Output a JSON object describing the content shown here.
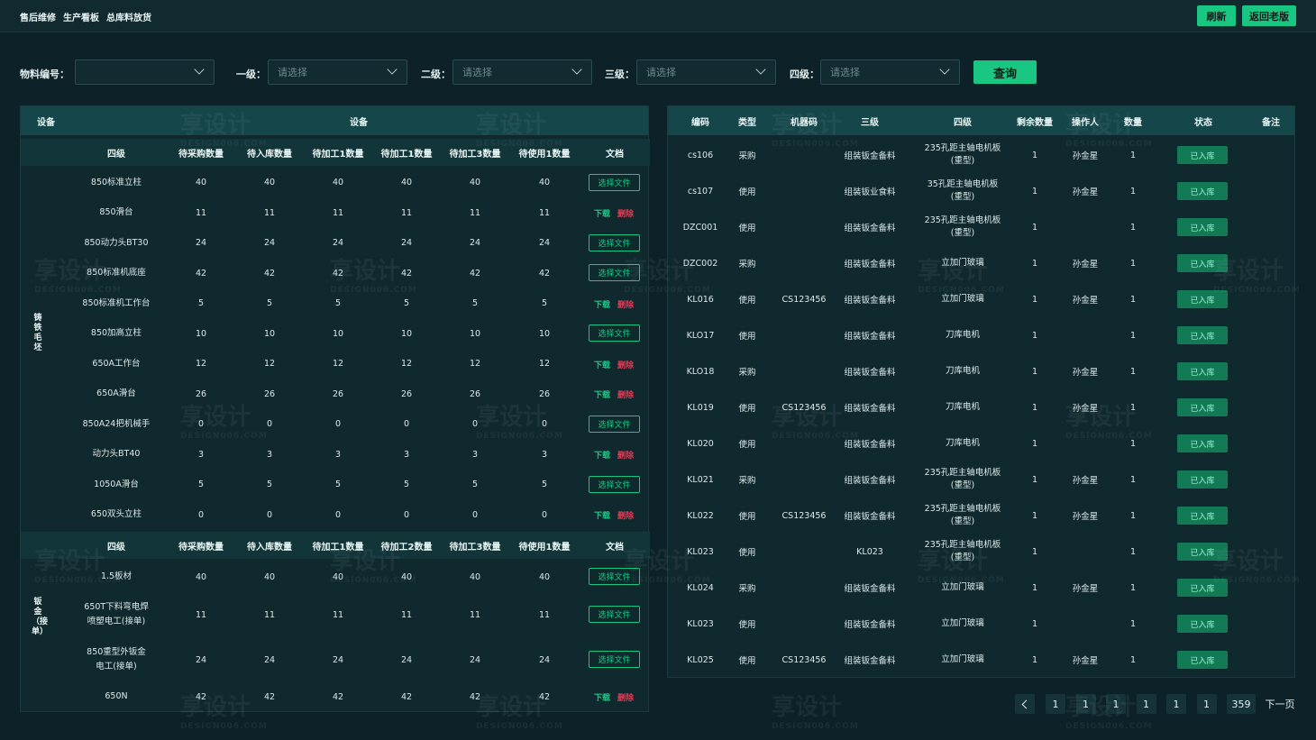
{
  "topnav": [
    "售后维修",
    "生产看板",
    "总库料放货"
  ],
  "buttons": {
    "refresh": "刷新",
    "old_version": "返回老版",
    "query": "查询"
  },
  "filters": {
    "material_label": "物料编号：",
    "material_value": "",
    "l1_label": "一级：",
    "l1_placeholder": "请选择",
    "l2_label": "二级：",
    "l2_placeholder": "请选择",
    "l3_label": "三级：",
    "l3_placeholder": "请选择",
    "l4_label": "四级：",
    "l4_placeholder": "请选择"
  },
  "left": {
    "head_device": "设备",
    "head_device2": "设备",
    "columns1": [
      "四级",
      "待采购数量",
      "待入库数量",
      "待加工1数量",
      "待加工1数量",
      "待加工3数量",
      "待使用1数量",
      "文档"
    ],
    "group1_label": "铸铁毛坯",
    "rows1": [
      {
        "name": "850标准立柱",
        "v": [
          "40",
          "40",
          "40",
          "40",
          "40",
          "40"
        ],
        "doc": "file"
      },
      {
        "name": "850滑台",
        "v": [
          "11",
          "11",
          "11",
          "11",
          "11",
          "11"
        ],
        "doc": "dl"
      },
      {
        "name": "850动力头BT30",
        "v": [
          "24",
          "24",
          "24",
          "24",
          "24",
          "24"
        ],
        "doc": "file"
      },
      {
        "name": "850标准机底座",
        "v": [
          "42",
          "42",
          "42",
          "42",
          "42",
          "42"
        ],
        "doc": "file"
      },
      {
        "name": "850标准机工作台",
        "v": [
          "5",
          "5",
          "5",
          "5",
          "5",
          "5"
        ],
        "doc": "dl"
      },
      {
        "name": "850加高立柱",
        "v": [
          "10",
          "10",
          "10",
          "10",
          "10",
          "10"
        ],
        "doc": "file"
      },
      {
        "name": "650A工作台",
        "v": [
          "12",
          "12",
          "12",
          "12",
          "12",
          "12"
        ],
        "doc": "dl"
      },
      {
        "name": "650A滑台",
        "v": [
          "26",
          "26",
          "26",
          "26",
          "26",
          "26"
        ],
        "doc": "dl"
      },
      {
        "name": "850A24把机械手",
        "v": [
          "0",
          "0",
          "0",
          "0",
          "0",
          "0"
        ],
        "doc": "file"
      },
      {
        "name": "动力头BT40",
        "v": [
          "3",
          "3",
          "3",
          "3",
          "3",
          "3"
        ],
        "doc": "dl"
      },
      {
        "name": "1050A滑台",
        "v": [
          "5",
          "5",
          "5",
          "5",
          "5",
          "5"
        ],
        "doc": "file"
      },
      {
        "name": "650双头立柱",
        "v": [
          "0",
          "0",
          "0",
          "0",
          "0",
          "0"
        ],
        "doc": "dl"
      }
    ],
    "columns2": [
      "四级",
      "待采购数量",
      "待入库数量",
      "待加工1数量",
      "待加工2数量",
      "待加工3数量",
      "待使用1数量",
      "文档"
    ],
    "group2_label": "钣金（接单）",
    "rows2": [
      {
        "name": "1.5板材",
        "v": [
          "40",
          "40",
          "40",
          "40",
          "40",
          "40"
        ],
        "doc": "file"
      },
      {
        "name": "650T下料弯电焊\n喷塑电工(接单)",
        "v": [
          "11",
          "11",
          "11",
          "11",
          "11",
          "11"
        ],
        "doc": "file"
      },
      {
        "name": "850重型外钣金\n电工(接单)",
        "v": [
          "24",
          "24",
          "24",
          "24",
          "24",
          "24"
        ],
        "doc": "file"
      },
      {
        "name": "650N",
        "v": [
          "42",
          "42",
          "42",
          "42",
          "42",
          "42"
        ],
        "doc": "dl"
      }
    ],
    "file_label": "选择文件",
    "download_label": "下载",
    "delete_label": "删除"
  },
  "right": {
    "columns": [
      "编码",
      "类型",
      "机器码",
      "三级",
      "四级",
      "剩余数量",
      "操作人",
      "数量",
      "状态",
      "备注"
    ],
    "status_label": "已入库",
    "rows": [
      {
        "code": "cs106",
        "type": "采购",
        "machine": "",
        "l3": "组装钣金备料",
        "l4": "235孔距主轴电机板\n(重型)",
        "remain": "1",
        "op": "孙金星",
        "qty": "1"
      },
      {
        "code": "cs107",
        "type": "使用",
        "machine": "",
        "l3": "组装钣业食料",
        "l4": "35孔距主轴电机板\n(重型)",
        "remain": "1",
        "op": "孙金星",
        "qty": "1"
      },
      {
        "code": "DZC001",
        "type": "使用",
        "machine": "",
        "l3": "组装钣金备料",
        "l4": "235孔距主轴电机板\n(重型)",
        "remain": "1",
        "op": "",
        "qty": "1"
      },
      {
        "code": "DZC002",
        "type": "采购",
        "machine": "",
        "l3": "组装钣金备料",
        "l4": "立加门玻璃",
        "remain": "1",
        "op": "孙金星",
        "qty": "1"
      },
      {
        "code": "KL016",
        "type": "使用",
        "machine": "CS123456",
        "l3": "组装钣金备料",
        "l4": "立加门玻璃",
        "remain": "1",
        "op": "孙金星",
        "qty": "1"
      },
      {
        "code": "KLO17",
        "type": "使用",
        "machine": "",
        "l3": "组装钣金备料",
        "l4": "刀库电机",
        "remain": "1",
        "op": "",
        "qty": "1"
      },
      {
        "code": "KLO18",
        "type": "采购",
        "machine": "",
        "l3": "组装钣金备料",
        "l4": "刀库电机",
        "remain": "1",
        "op": "孙金星",
        "qty": "1"
      },
      {
        "code": "KL019",
        "type": "使用",
        "machine": "CS123456",
        "l3": "组装钣金备料",
        "l4": "刀库电机",
        "remain": "1",
        "op": "孙金星",
        "qty": "1"
      },
      {
        "code": "KL020",
        "type": "使用",
        "machine": "",
        "l3": "组装钣金备料",
        "l4": "刀库电机",
        "remain": "1",
        "op": "",
        "qty": "1"
      },
      {
        "code": "KL021",
        "type": "采购",
        "machine": "",
        "l3": "组装钣金备料",
        "l4": "235孔距主轴电机板\n(重型)",
        "remain": "1",
        "op": "孙金星",
        "qty": "1"
      },
      {
        "code": "KL022",
        "type": "使用",
        "machine": "CS123456",
        "l3": "组装钣金备料",
        "l4": "235孔距主轴电机板\n(重型)",
        "remain": "1",
        "op": "孙金星",
        "qty": "1"
      },
      {
        "code": "KL023",
        "type": "使用",
        "machine": "",
        "l3": "KL023",
        "l4": "235孔距主轴电机板\n(重型)",
        "remain": "1",
        "op": "",
        "qty": "1"
      },
      {
        "code": "KL024",
        "type": "采购",
        "machine": "",
        "l3": "组装钣金备料",
        "l4": "立加门玻璃",
        "remain": "1",
        "op": "孙金星",
        "qty": "1"
      },
      {
        "code": "KL023",
        "type": "使用",
        "machine": "",
        "l3": "组装钣金备料",
        "l4": "立加门玻璃",
        "remain": "1",
        "op": "",
        "qty": "1"
      },
      {
        "code": "KL025",
        "type": "使用",
        "machine": "CS123456",
        "l3": "组装钣金备料",
        "l4": "立加门玻璃",
        "remain": "1",
        "op": "孙金星",
        "qty": "1"
      }
    ]
  },
  "pager": {
    "pages": [
      "1",
      "1",
      "1",
      "1",
      "1",
      "1",
      "359"
    ],
    "next": "下一页"
  },
  "watermark": {
    "text": "享设计",
    "sub": "DESIGN006.COM"
  }
}
